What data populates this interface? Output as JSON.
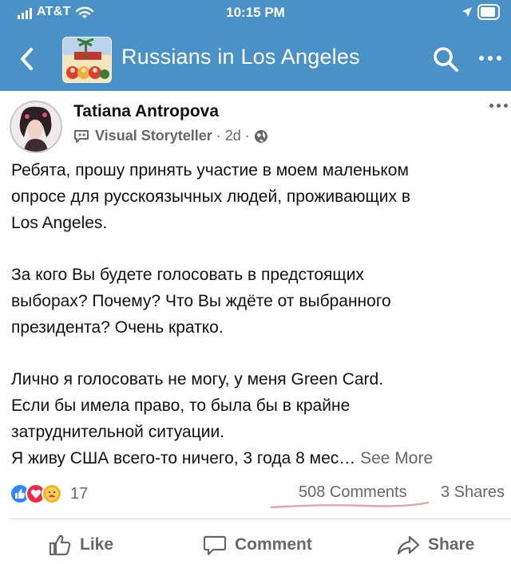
{
  "status_bar": {
    "carrier": "AT&T",
    "time": "10:15 PM"
  },
  "nav": {
    "group_name": "Russians in Los Angeles",
    "icons": [
      "back-icon",
      "search-icon",
      "more-icon"
    ]
  },
  "post": {
    "author": "Tatiana Antropova",
    "badge": "Visual Storyteller",
    "time": "· 2d ·",
    "paragraphs": [
      "Ребята, прошу принять участие в моем маленьком",
      "опросе для русскоязычных людей, проживающих в",
      "Los Angeles.",
      "За кого Вы будете голосовать в предстоящих",
      "выборах? Почему? Что Вы ждёте от выбранного",
      "президента? Очень кратко.",
      "Лично я голосовать не могу, у меня Green Card.",
      "Если бы имела право, то была бы в крайне",
      "затруднительной ситуации.",
      "Я живу США всего-то ничего, 3 года 8 мес…"
    ],
    "see_more": "See More"
  },
  "engagement": {
    "reaction_count": "17",
    "comments": "508 Comments",
    "shares": "3 Shares",
    "reactions": [
      "like",
      "love",
      "care"
    ]
  },
  "actions": {
    "like": "Like",
    "comment": "Comment",
    "share": "Share"
  },
  "colors": {
    "header_bg": "#4a91c7",
    "muted_text": "#65676b",
    "annotation": "#e0a5a5"
  }
}
